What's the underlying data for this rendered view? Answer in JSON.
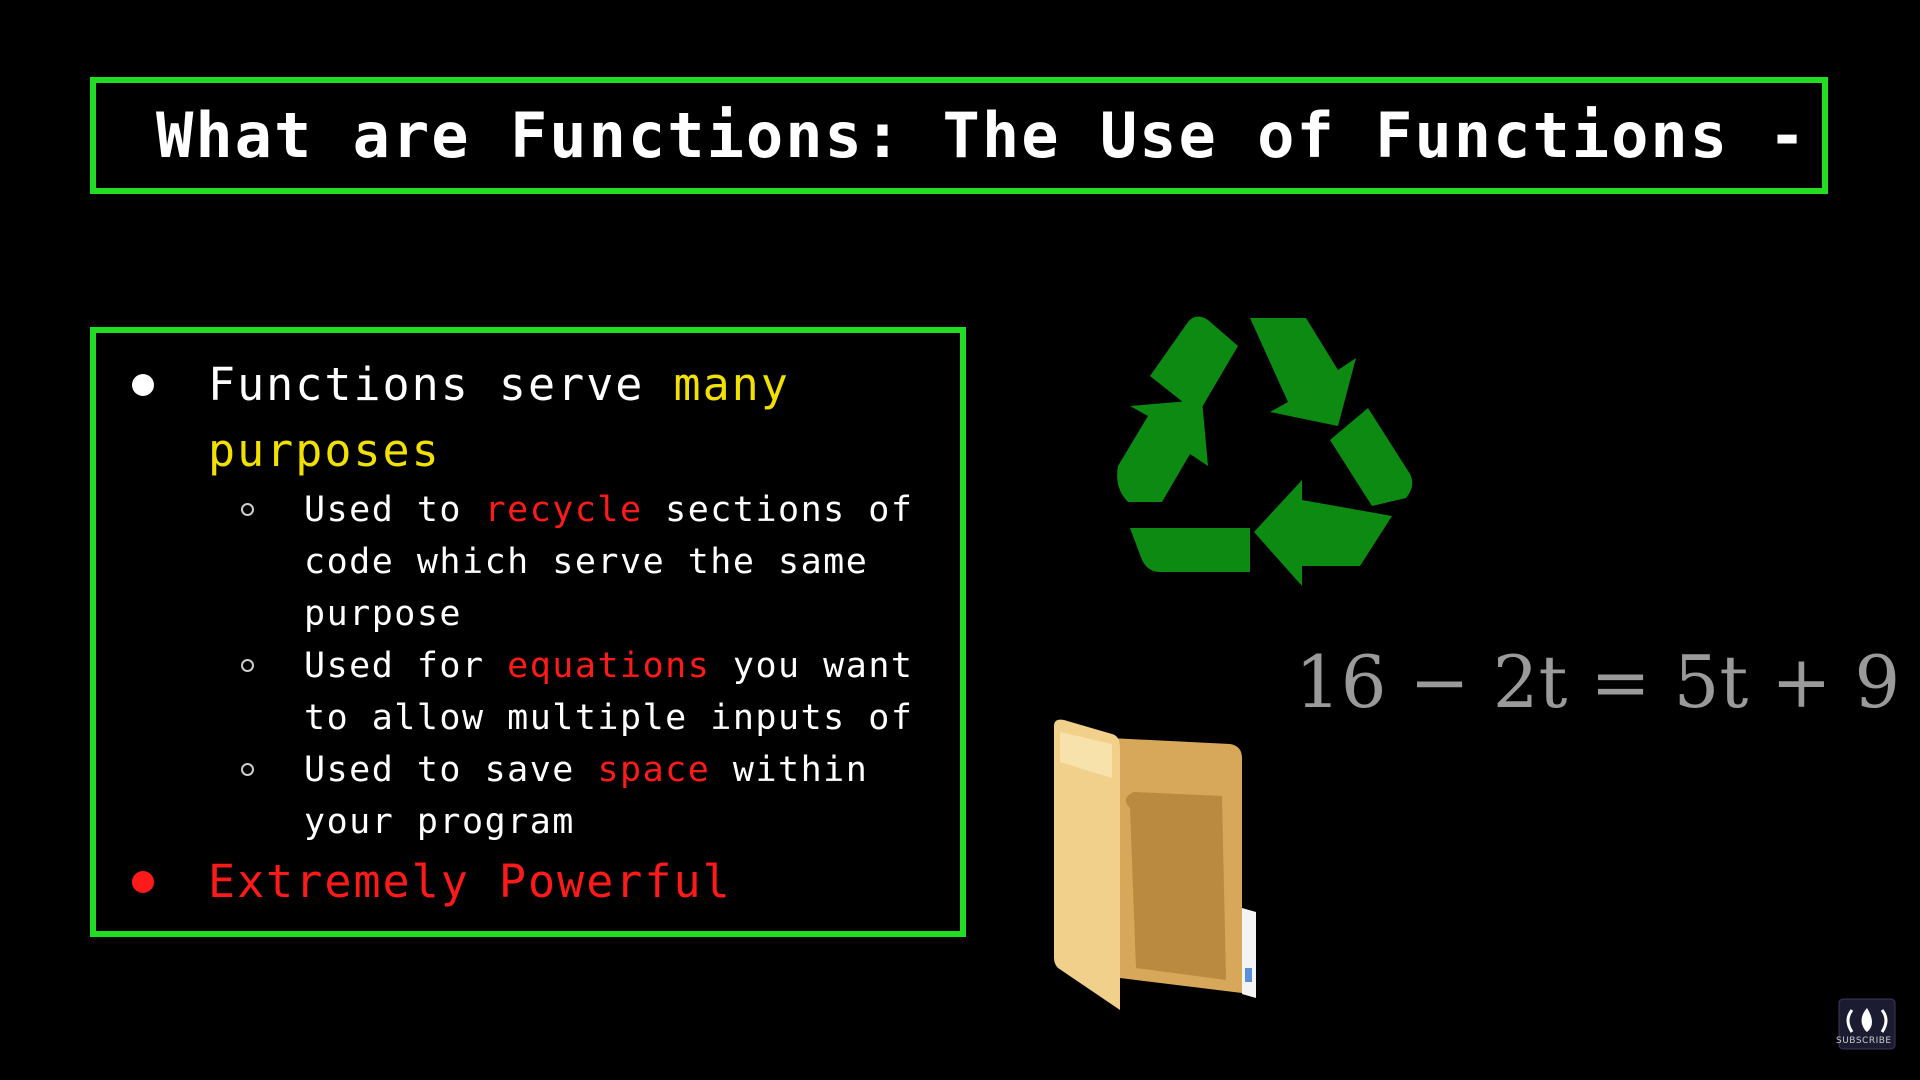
{
  "title": "What are Functions: The Use of Functions -",
  "bullets": {
    "b1_line1_a": "Functions serve ",
    "b1_line1_b": "many",
    "b1_line2": "purposes",
    "sub1_line1_a": "Used to ",
    "sub1_line1_b": "recycle",
    "sub1_line1_c": " sections of",
    "sub1_line2": "code which serve the same",
    "sub1_line3": "purpose",
    "sub2_line1_a": "Used for ",
    "sub2_line1_b": "equations",
    "sub2_line1_c": " you want",
    "sub2_line2": "to allow multiple inputs of",
    "sub3_line1_a": "Used to save ",
    "sub3_line1_b": "space",
    "sub3_line1_c": " within",
    "sub3_line2": "your program",
    "b2": "Extremely Powerful"
  },
  "equation": "16 − 2t = 5t + 9",
  "subscribe": "SUBSCRIBE",
  "icons": {
    "recycle": "recycle-icon",
    "folder": "folder-icon",
    "channel_logo": "freecodecamp-logo-icon"
  },
  "colors": {
    "border": "#22dd22",
    "highlight_yellow": "#f1e000",
    "highlight_red": "#ff1a1a",
    "recycle_green": "#0c8a12",
    "folder": "#e9c275"
  }
}
